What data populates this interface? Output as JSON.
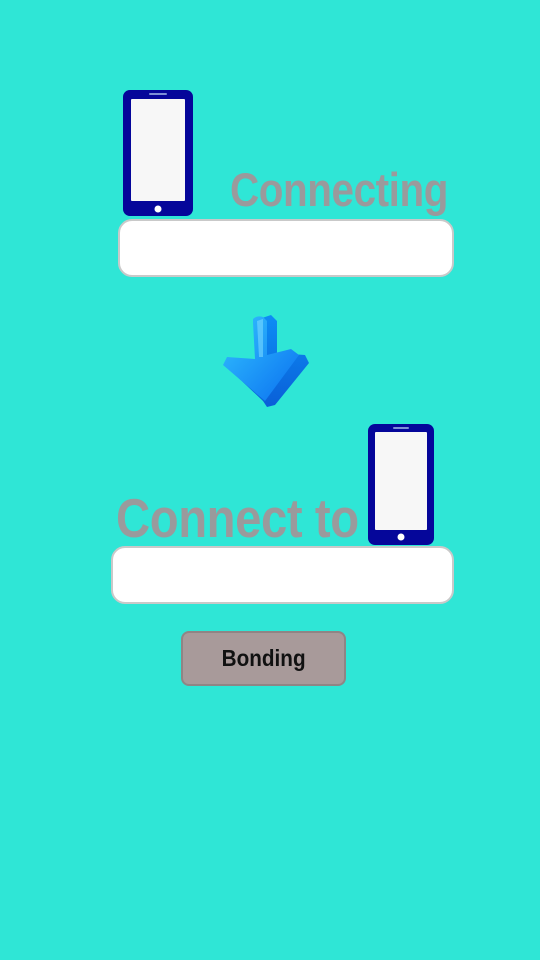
{
  "source": {
    "label": "Connecting",
    "field_value": "",
    "field_placeholder": "",
    "icon": "smartphone-icon"
  },
  "transfer_icon": "arrow-down-icon",
  "target": {
    "label": "Connect to",
    "field_value": "",
    "field_placeholder": "",
    "icon": "smartphone-icon"
  },
  "actions": {
    "bonding_label": "Bonding"
  },
  "colors": {
    "background": "#2fe6d6",
    "phone_body": "#05069a",
    "phone_screen": "#f7f7f7",
    "label_text": "#9a9a9c",
    "button_fill": "#a89a9a",
    "arrow_light": "#33c4ff",
    "arrow_dark": "#0a6ff0"
  }
}
